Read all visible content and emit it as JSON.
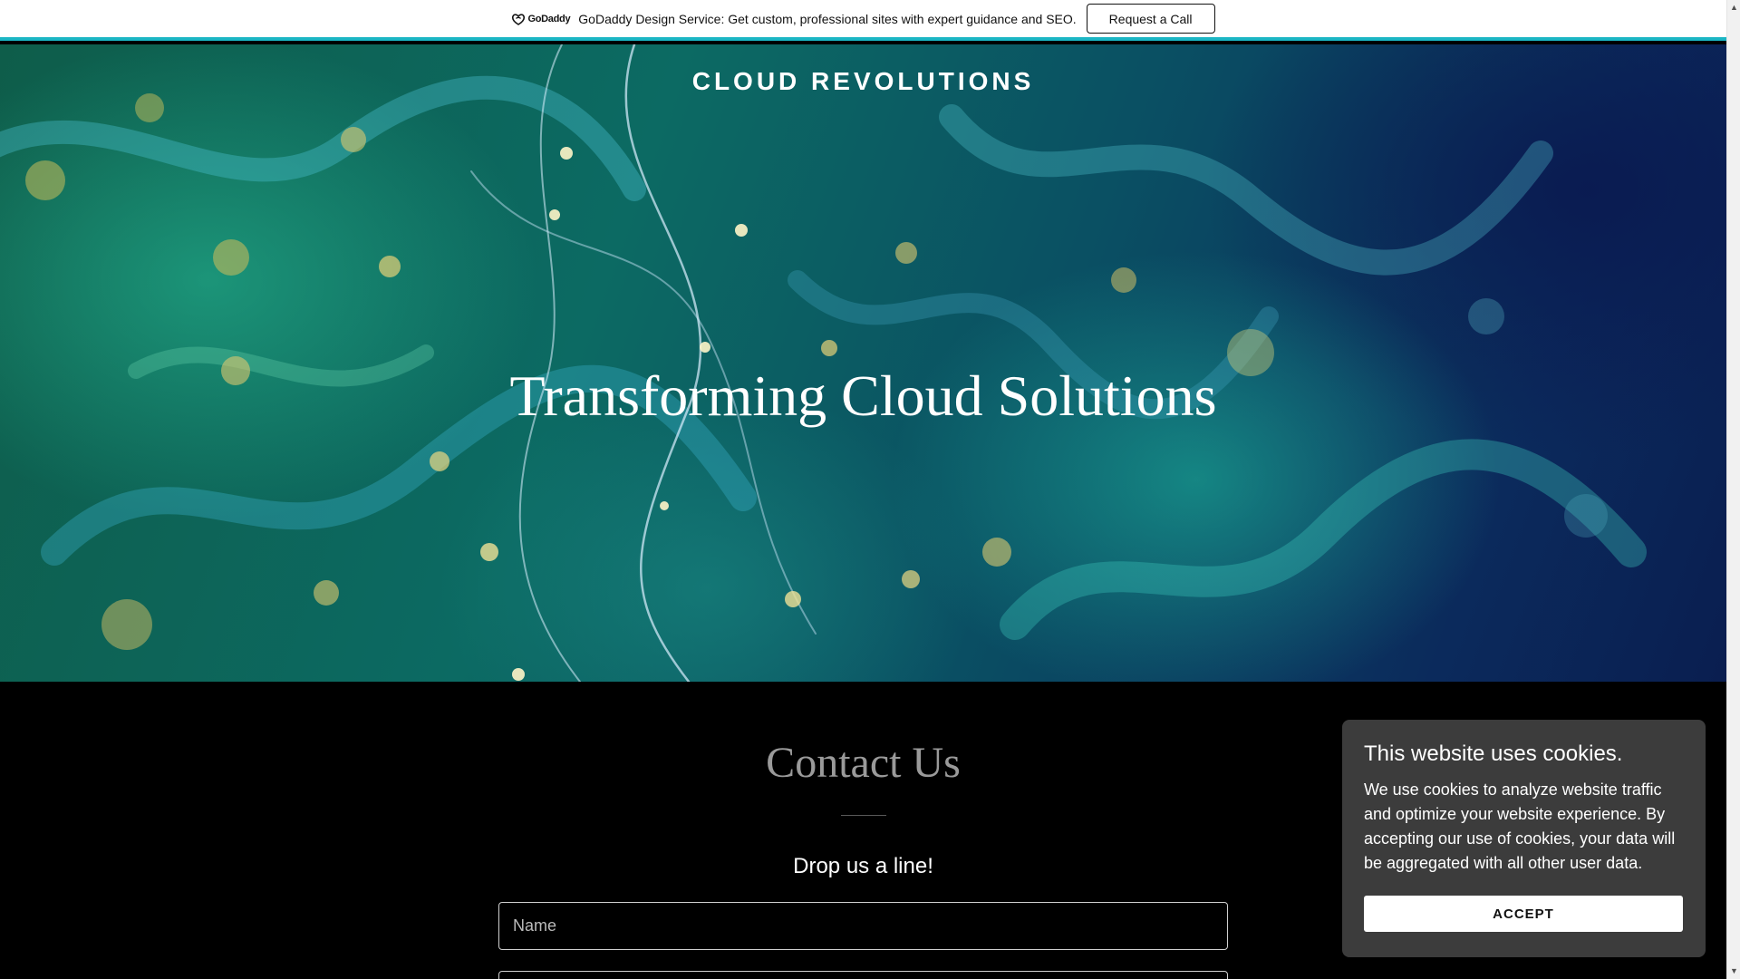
{
  "promo_bar": {
    "logo_text": "GoDaddy",
    "message": "GoDaddy Design Service: Get custom, professional sites with expert guidance and SEO.",
    "cta_label": "Request a Call"
  },
  "hero": {
    "site_title": "CLOUD REVOLUTIONS",
    "heading": "Transforming Cloud Solutions"
  },
  "contact": {
    "title": "Contact Us",
    "subtitle": "Drop us a line!",
    "name_placeholder": "Name"
  },
  "cookie_banner": {
    "title": "This website uses cookies.",
    "body": "We use cookies to analyze website traffic and optimize your website experience. By accepting our use of cookies, your data will be aggregated with all other user data.",
    "accept_label": "ACCEPT"
  },
  "colors": {
    "promo_accent": "#1bb6c4",
    "page_background": "#000000",
    "cookie_background": "#3c3c3c"
  },
  "icons": {
    "logo": "godaddy-logo-icon",
    "scroll_up": "chevron-up-icon",
    "scroll_down": "chevron-down-icon"
  }
}
